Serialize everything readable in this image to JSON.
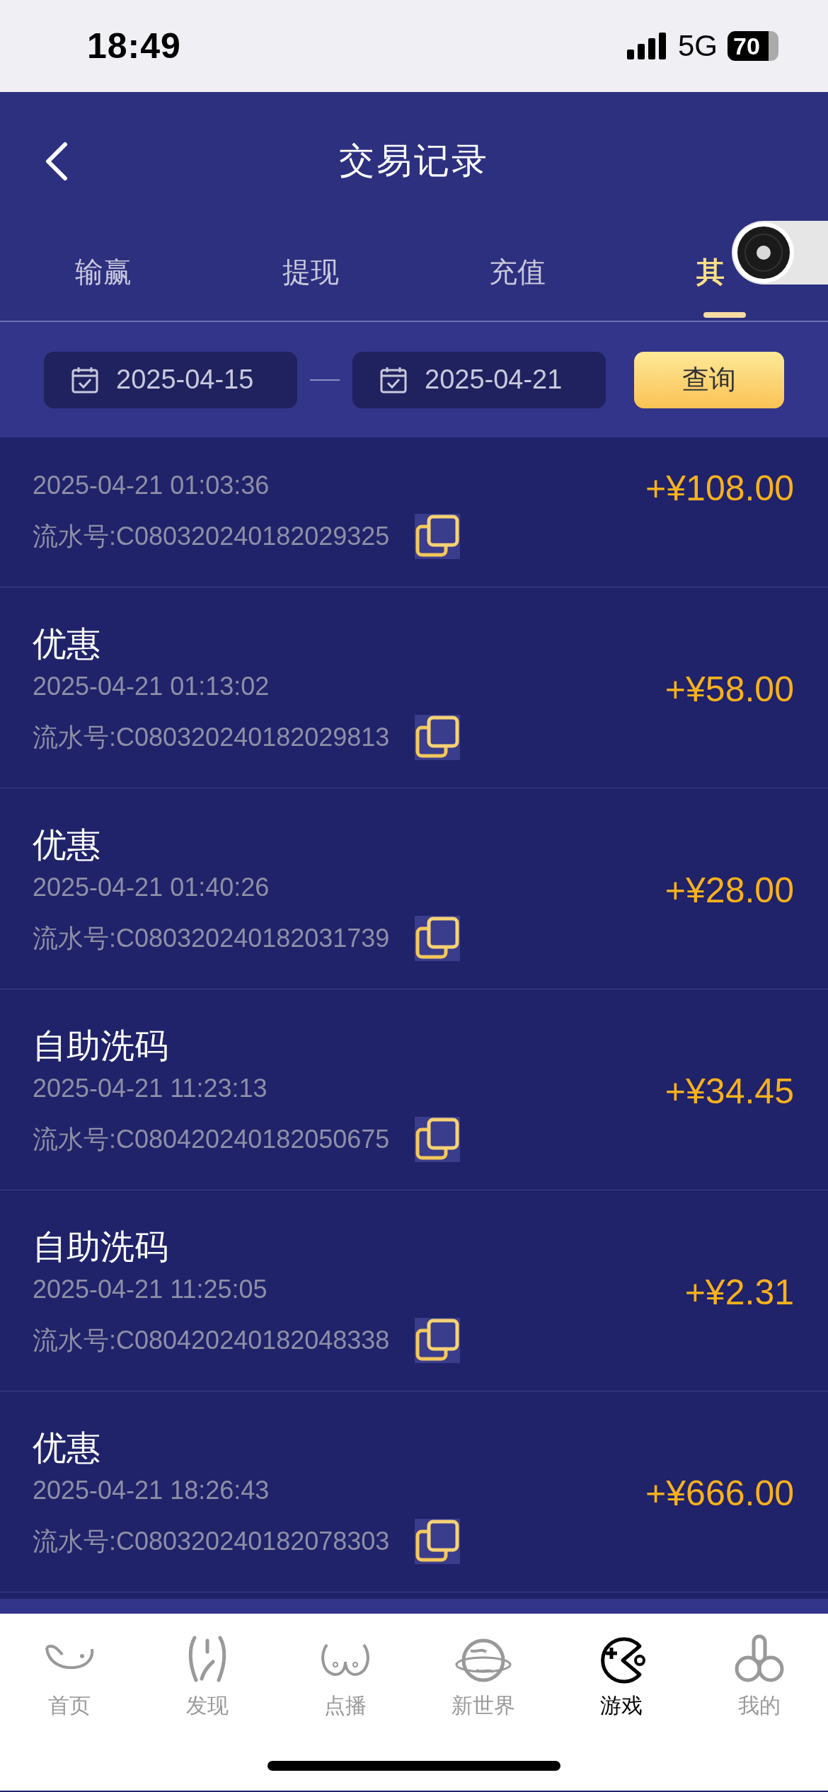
{
  "status_bar": {
    "time": "18:49",
    "network": "5G",
    "battery": "70"
  },
  "header": {
    "title": "交易记录"
  },
  "tabs": [
    {
      "label": "输赢",
      "selected": false
    },
    {
      "label": "提现",
      "selected": false
    },
    {
      "label": "充值",
      "selected": false
    },
    {
      "label": "其",
      "selected": true
    }
  ],
  "date_filter": {
    "start": "2025-04-15",
    "end": "2025-04-21",
    "query_button": "查询"
  },
  "records": [
    {
      "time": "2025-04-21 01:03:36",
      "serial": "流水号:C080320240182029325",
      "amount": "+¥108.00"
    },
    {
      "title": "优惠",
      "time": "2025-04-21 01:13:02",
      "serial": "流水号:C080320240182029813",
      "amount": "+¥58.00"
    },
    {
      "title": "优惠",
      "time": "2025-04-21 01:40:26",
      "serial": "流水号:C080320240182031739",
      "amount": "+¥28.00"
    },
    {
      "title": "自助洗码",
      "time": "2025-04-21 11:23:13",
      "serial": "流水号:C080420240182050675",
      "amount": "+¥34.45"
    },
    {
      "title": "自助洗码",
      "time": "2025-04-21 11:25:05",
      "serial": "流水号:C080420240182048338",
      "amount": "+¥2.31"
    },
    {
      "title": "优惠",
      "time": "2025-04-21 18:26:43",
      "serial": "流水号:C080320240182078303",
      "amount": "+¥666.00"
    }
  ],
  "bottom_nav": [
    {
      "label": "首页",
      "selected": false
    },
    {
      "label": "发现",
      "selected": false
    },
    {
      "label": "点播",
      "selected": false
    },
    {
      "label": "新世界",
      "selected": false
    },
    {
      "label": "游戏",
      "selected": true
    },
    {
      "label": "我的",
      "selected": false
    }
  ]
}
